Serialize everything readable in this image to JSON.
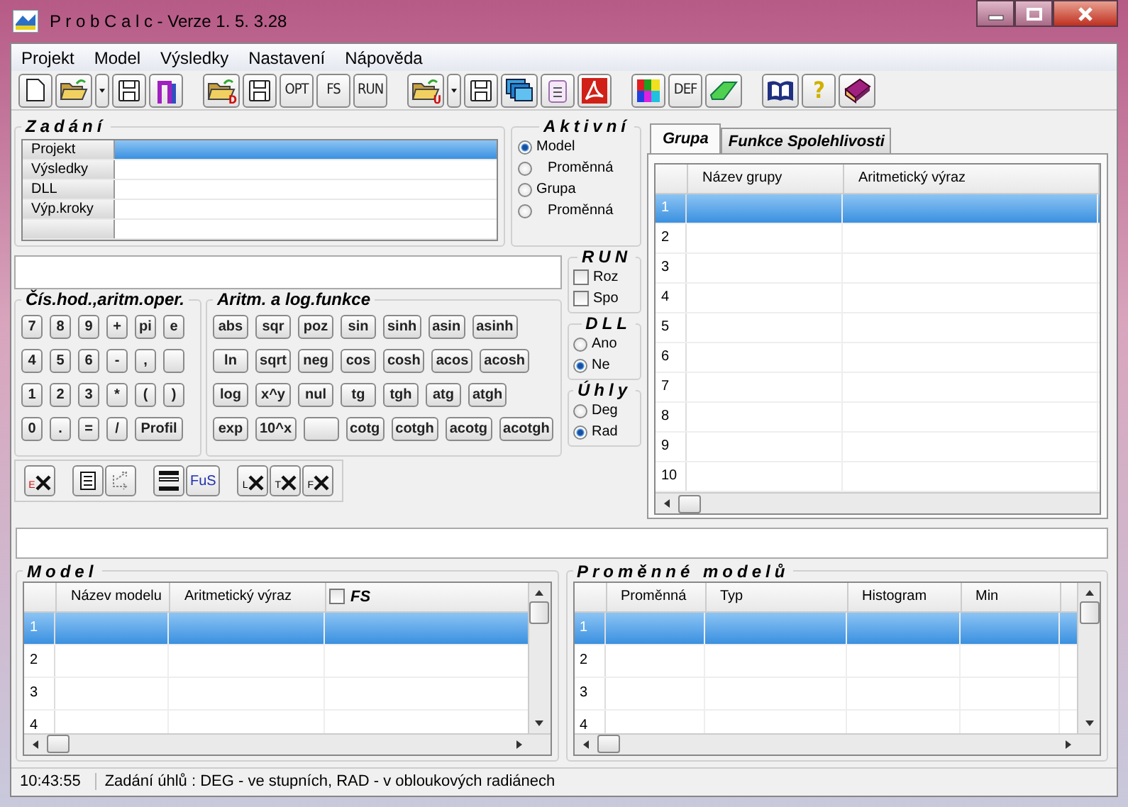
{
  "window": {
    "title": "P r o b C a l c  -  Verze 1. 5. 3.28"
  },
  "menu": [
    {
      "label": "Projekt"
    },
    {
      "label": "Model"
    },
    {
      "label": "Výsledky"
    },
    {
      "label": "Nastavení"
    },
    {
      "label": "Nápověda"
    }
  ],
  "toolbar": [
    [
      {
        "kind": "icon"
      },
      {
        "kind": "icon"
      },
      {
        "kind": "icon"
      },
      {
        "kind": "icon"
      },
      {
        "kind": "icon"
      }
    ],
    [
      {
        "kind": "icon",
        "badge": "D"
      },
      {
        "kind": "icon"
      },
      {
        "kind": "text",
        "label": "OPT"
      },
      {
        "kind": "text",
        "label": "FS"
      },
      {
        "kind": "text",
        "label": "RUN"
      }
    ],
    [
      {
        "kind": "icon",
        "badge": "U"
      },
      {
        "kind": "icon"
      },
      {
        "kind": "icon"
      },
      {
        "kind": "icon"
      },
      {
        "kind": "icon"
      },
      {
        "kind": "icon"
      }
    ],
    [
      {
        "kind": "icon"
      },
      {
        "kind": "text",
        "label": "DEF"
      },
      {
        "kind": "icon"
      }
    ],
    [
      {
        "kind": "icon"
      },
      {
        "kind": "text",
        "label": "?"
      },
      {
        "kind": "icon"
      }
    ]
  ],
  "zadani": {
    "title": "Zadání",
    "rows": [
      {
        "label": "Projekt",
        "selected": true
      },
      {
        "label": "Výsledky",
        "selected": false
      },
      {
        "label": "DLL",
        "selected": false
      },
      {
        "label": "Výp.kroky",
        "selected": false
      },
      {
        "selected": false
      }
    ]
  },
  "aktivni": {
    "title": "Aktivní",
    "options": [
      {
        "label": "Model",
        "selected": true,
        "indent": false
      },
      {
        "label": "Proměnná",
        "selected": false,
        "indent": true
      },
      {
        "label": "Grupa",
        "selected": false,
        "indent": false
      },
      {
        "label": "Proměnná",
        "selected": false,
        "indent": true
      }
    ]
  },
  "run": {
    "title": "RUN",
    "options": [
      {
        "label": "Roz",
        "checked": false
      },
      {
        "label": "Spo",
        "checked": false
      }
    ]
  },
  "dll": {
    "title": "DLL",
    "options": [
      {
        "label": "Ano",
        "selected": false
      },
      {
        "label": "Ne",
        "selected": true
      }
    ]
  },
  "uhly": {
    "title": "Úhly",
    "options": [
      {
        "label": "Deg",
        "selected": false
      },
      {
        "label": "Rad",
        "selected": true
      }
    ]
  },
  "keypad": {
    "title": "Čís.hod.,aritm.oper.",
    "rows": [
      [
        {
          "kind": "key",
          "label": "7"
        },
        {
          "kind": "key",
          "label": "8"
        },
        {
          "kind": "key",
          "label": "9"
        },
        {
          "kind": "key",
          "label": "+"
        },
        {
          "kind": "key",
          "label": "pi"
        },
        {
          "kind": "key",
          "label": "e"
        }
      ],
      [
        {
          "kind": "key",
          "label": "4"
        },
        {
          "kind": "key",
          "label": "5"
        },
        {
          "kind": "key",
          "label": "6"
        },
        {
          "kind": "key",
          "label": "-"
        },
        {
          "kind": "key",
          "label": ","
        },
        {
          "kind": "blank"
        }
      ],
      [
        {
          "kind": "key",
          "label": "1"
        },
        {
          "kind": "key",
          "label": "2"
        },
        {
          "kind": "key",
          "label": "3"
        },
        {
          "kind": "key",
          "label": "*"
        },
        {
          "kind": "key",
          "label": "("
        },
        {
          "kind": "key",
          "label": ")"
        }
      ],
      [
        {
          "kind": "key",
          "label": "0"
        },
        {
          "kind": "key",
          "label": "."
        },
        {
          "kind": "key",
          "label": "="
        },
        {
          "kind": "key",
          "label": "/"
        },
        {
          "kind": "wide",
          "label": "Profil"
        }
      ]
    ]
  },
  "functions": {
    "title": "Aritm. a log.funkce",
    "rows": [
      [
        {
          "kind": "key",
          "label": "abs"
        },
        {
          "kind": "key",
          "label": "sqr"
        },
        {
          "kind": "key",
          "label": "poz"
        },
        {
          "kind": "key",
          "label": "sin"
        },
        {
          "kind": "key",
          "label": "sinh"
        },
        {
          "kind": "key",
          "label": "asin"
        },
        {
          "kind": "key",
          "label": "asinh"
        }
      ],
      [
        {
          "kind": "key",
          "label": "ln"
        },
        {
          "kind": "key",
          "label": "sqrt"
        },
        {
          "kind": "key",
          "label": "neg"
        },
        {
          "kind": "key",
          "label": "cos"
        },
        {
          "kind": "key",
          "label": "cosh"
        },
        {
          "kind": "key",
          "label": "acos"
        },
        {
          "kind": "key",
          "label": "acosh"
        }
      ],
      [
        {
          "kind": "key",
          "label": "log"
        },
        {
          "kind": "key",
          "label": "x^y"
        },
        {
          "kind": "key",
          "label": "nul"
        },
        {
          "kind": "key",
          "label": "tg"
        },
        {
          "kind": "key",
          "label": "tgh"
        },
        {
          "kind": "key",
          "label": "atg"
        },
        {
          "kind": "key",
          "label": "atgh"
        }
      ],
      [
        {
          "kind": "key",
          "label": "exp"
        },
        {
          "kind": "key",
          "label": "10^x"
        },
        {
          "kind": "blank"
        },
        {
          "kind": "key",
          "label": "cotg"
        },
        {
          "kind": "key",
          "label": "cotgh"
        },
        {
          "kind": "key",
          "label": "acotg"
        },
        {
          "kind": "key",
          "label": "acotgh"
        }
      ]
    ]
  },
  "edit_toolbar": [
    [
      {
        "kind": "clear",
        "label": "E"
      }
    ],
    [
      {
        "kind": "icon"
      },
      {
        "kind": "icon"
      }
    ],
    [
      {
        "kind": "icon"
      },
      {
        "kind": "text",
        "label": "FuS"
      }
    ],
    [
      {
        "kind": "clear",
        "label": "L"
      },
      {
        "kind": "clear",
        "label": "T"
      },
      {
        "kind": "clear",
        "label": "F"
      }
    ]
  ],
  "tabs": [
    {
      "label": "Grupa",
      "selected": true
    },
    {
      "label": "Funkce Spolehlivosti",
      "selected": false
    }
  ],
  "group_table": {
    "columns": [
      "Název grupy",
      "Aritmetický výraz"
    ],
    "rows": [
      {
        "number": "1",
        "selected": true
      },
      {
        "number": "2",
        "selected": false
      },
      {
        "number": "3",
        "selected": false
      },
      {
        "number": "4",
        "selected": false
      },
      {
        "number": "5",
        "selected": false
      },
      {
        "number": "6",
        "selected": false
      },
      {
        "number": "7",
        "selected": false
      },
      {
        "number": "8",
        "selected": false
      },
      {
        "number": "9",
        "selected": false
      },
      {
        "number": "10",
        "selected": false
      }
    ]
  },
  "model": {
    "title": "Model",
    "columns": [
      "Název modelu",
      "Aritmetický výraz"
    ],
    "fs": {
      "label": "FS",
      "checked": false
    },
    "rows": [
      {
        "number": "1",
        "selected": true
      },
      {
        "number": "2",
        "selected": false
      },
      {
        "number": "3",
        "selected": false
      },
      {
        "number": "4",
        "selected": false
      }
    ]
  },
  "variables": {
    "title": "Proměnné modelů",
    "columns": [
      "Proměnná",
      "Typ",
      "Histogram",
      "Min"
    ],
    "rows": [
      {
        "number": "1",
        "selected": true
      },
      {
        "number": "2",
        "selected": false
      },
      {
        "number": "3",
        "selected": false
      },
      {
        "number": "4",
        "selected": false
      }
    ]
  },
  "status_bar": {
    "time": "10:43:55",
    "message": "Zadání úhlů : DEG - ve stupních, RAD - v obloukových radiánech"
  }
}
